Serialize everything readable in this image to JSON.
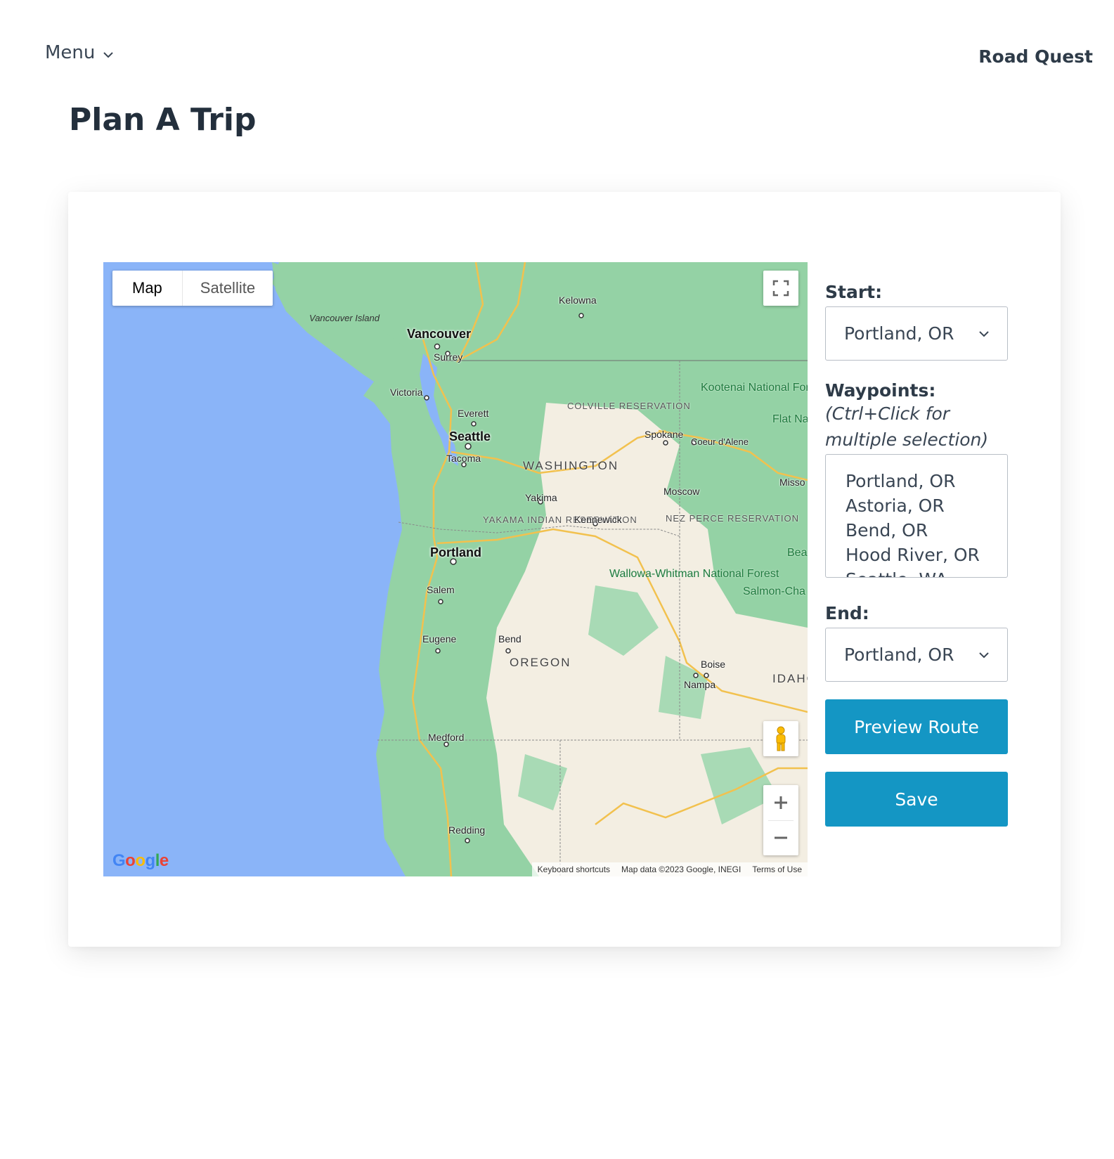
{
  "header": {
    "menu_label": "Menu",
    "brand": "Road Quest"
  },
  "page": {
    "title": "Plan A Trip"
  },
  "map": {
    "type_buttons": [
      "Map",
      "Satellite"
    ],
    "active_type": "Map",
    "google_logo": "Google",
    "attribution": [
      "Keyboard shortcuts",
      "Map data ©2023 Google, INEGI",
      "Terms of Use"
    ],
    "labels": {
      "vancouver_island": "Vancouver Island",
      "vancouver": "Vancouver",
      "surrey": "Surrey",
      "victoria": "Victoria",
      "kelowna": "Kelowna",
      "everett": "Everett",
      "seattle": "Seattle",
      "tacoma": "Tacoma",
      "colville": "COLVILLE RESERVATION",
      "washington": "WASHINGTON",
      "spokane": "Spokane",
      "coeur": "Coeur d'Alene",
      "kootenai": "Kootenai National Forest",
      "flathead": "Flat Nationa",
      "missoula": "Misso",
      "moscow": "Moscow",
      "yakima": "Yakima",
      "yakama": "YAKAMA INDIAN RESERVATION",
      "kennewick": "Kennewick",
      "nezperce": "NEZ PERCE RESERVATION",
      "portland": "Portland",
      "salem": "Salem",
      "wallowa": "Wallowa-Whitman National Forest",
      "salmon": "Salmon-Cha National For",
      "bea": "Bea",
      "eugene": "Eugene",
      "bend": "Bend",
      "oregon": "OREGON",
      "boise": "Boise",
      "nampa": "Nampa",
      "idaho": "IDAHO",
      "medford": "Medford",
      "redding": "Redding"
    }
  },
  "form": {
    "start_label": "Start:",
    "start_value": "Portland, OR",
    "waypoints_label": "Waypoints:",
    "waypoints_hint": "(Ctrl+Click for multiple selection)",
    "waypoints_options": [
      "Portland, OR",
      "Astoria, OR",
      "Bend, OR",
      "Hood River, OR",
      "Seattle, WA"
    ],
    "end_label": "End:",
    "end_value": "Portland, OR",
    "preview_button": "Preview Route",
    "save_button": "Save"
  }
}
